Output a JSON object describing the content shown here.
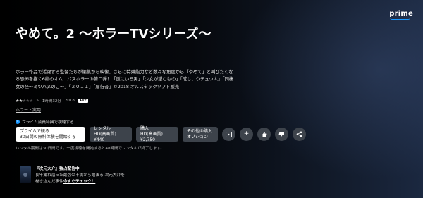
{
  "brand": {
    "logo_text": "prime"
  },
  "title": "やめて。2 〜ホラーTVシリーズ〜",
  "synopsis": "ホラー作品で活躍する監督たちが編集から映像、さらに特殊能力など数々な角度から「やめて」と叫びたくなる恐怖を描く6編のオムニバスホラーの第二弾！「逝にいる男」「少女が望むもの」「成し、ウチュウ人」「同棲女の怪〜ミツバメのこ〜」「２０１１」「届行者」©2018 オルスタックソフト販売",
  "meta": {
    "stars_filled": "★★",
    "stars_empty": "★★★",
    "rating_count": "5",
    "duration": "1時間32分",
    "year": "2018",
    "age_badge": "18+"
  },
  "genre": "ホラー・実用",
  "prime_note": "プライム会員特典で視聴する",
  "actions": {
    "primary_line1": "プライムで観る",
    "primary_line2": "30日間の無料体験を開始する",
    "rent_line1": "レンタル",
    "rent_line2": "HD(高画質) ¥440",
    "buy_line1": "購入",
    "buy_line2": "HD(高画質) ¥2,750",
    "other_line1": "その他の購入",
    "other_line2": "オプション"
  },
  "icons": {
    "trailer": "▶",
    "add": "+",
    "like": "👍",
    "dislike": "👎",
    "share": "⤴"
  },
  "disclaimer": "レンタル期間は30日間です。一度視聴を開始すると48時間でレンタルが終了します。",
  "promo": {
    "title": "『次元大介』独占配信中",
    "line1": "長年撮れ溜った最強の不満から始まる 次元大介を",
    "line2_prefix": "巻き込んだ事件",
    "link": "今すぐチェック！"
  }
}
